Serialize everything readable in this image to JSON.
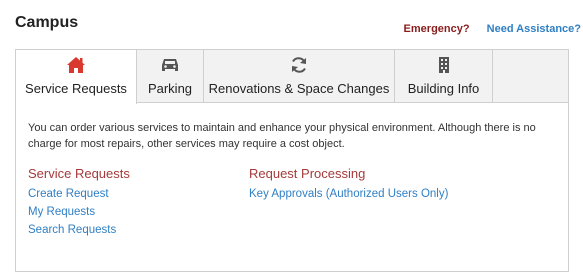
{
  "header": {
    "title": "Campus",
    "emergency_label": "Emergency?",
    "assistance_label": "Need Assistance?"
  },
  "tabs": [
    {
      "label": "Service Requests",
      "icon": "home-icon",
      "active": true
    },
    {
      "label": "Parking",
      "icon": "car-icon",
      "active": false
    },
    {
      "label": "Renovations & Space Changes",
      "icon": "refresh-icon",
      "active": false
    },
    {
      "label": "Building Info",
      "icon": "building-icon",
      "active": false
    }
  ],
  "content": {
    "description": "You can order various services to maintain and enhance your physical environment. Although there is no charge for most repairs, other services may require a cost object.",
    "left_section": {
      "heading": "Service Requests",
      "links": [
        "Create Request",
        "My Requests",
        "Search Requests"
      ]
    },
    "right_section": {
      "heading": "Request Processing",
      "links": [
        "Key Approvals (Authorized Users Only)"
      ]
    }
  },
  "colors": {
    "active_icon": "#d9382f",
    "icon": "#555555",
    "heading": "#a33b3b",
    "link": "#2f7fc4",
    "emergency": "#8a1c1c"
  }
}
